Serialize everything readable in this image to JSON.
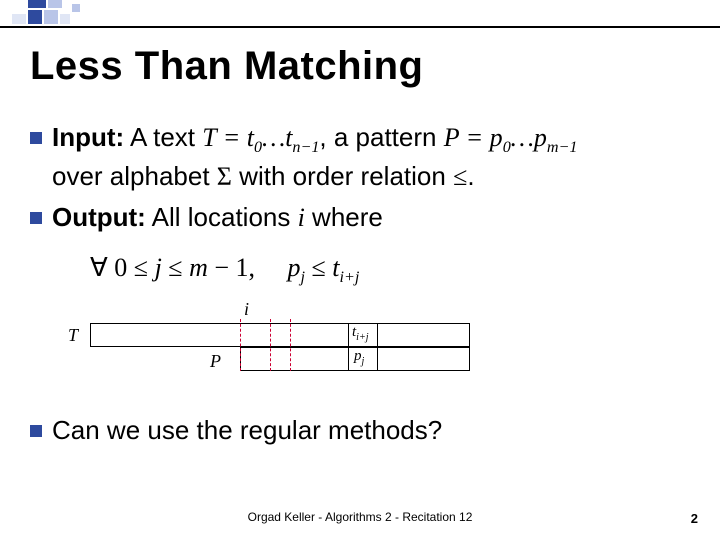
{
  "title": "Less Than Matching",
  "bullets": {
    "input_label": "Input:",
    "input_part1": " A text ",
    "input_T": "T = t",
    "input_T_sub1": "0",
    "input_T_mid": "…t",
    "input_T_sub2": "n−1",
    "input_part2": ", a pattern ",
    "input_P": "P = p",
    "input_P_sub1": "0",
    "input_P_mid": "…p",
    "input_P_sub2": "m−1",
    "input_line2a": "over alphabet ",
    "input_sigma": "Σ",
    "input_line2b": " with order relation ",
    "input_leq": "≤",
    "input_period": ".",
    "output_label": "Output:",
    "output_part1": " All locations ",
    "output_i": "i",
    "output_part2": " where",
    "question": "Can we use the regular methods?"
  },
  "formula": {
    "forall": "∀ 0 ≤ ",
    "j": "j",
    "mid": " ≤ ",
    "m": "m",
    "minus1": " − 1,",
    "gap": "     ",
    "pj": "p",
    "pj_sub": "j",
    "leq": " ≤ ",
    "t": "t",
    "t_sub": "i+j"
  },
  "diagram": {
    "i_label": "i",
    "T_label": "T",
    "P_label": "P",
    "t_label": "t",
    "t_sub": "i+j",
    "p_label": "p",
    "p_sub": "j"
  },
  "footer": "Orgad Keller - Algorithms 2 - Recitation 12",
  "pagenum": "2"
}
